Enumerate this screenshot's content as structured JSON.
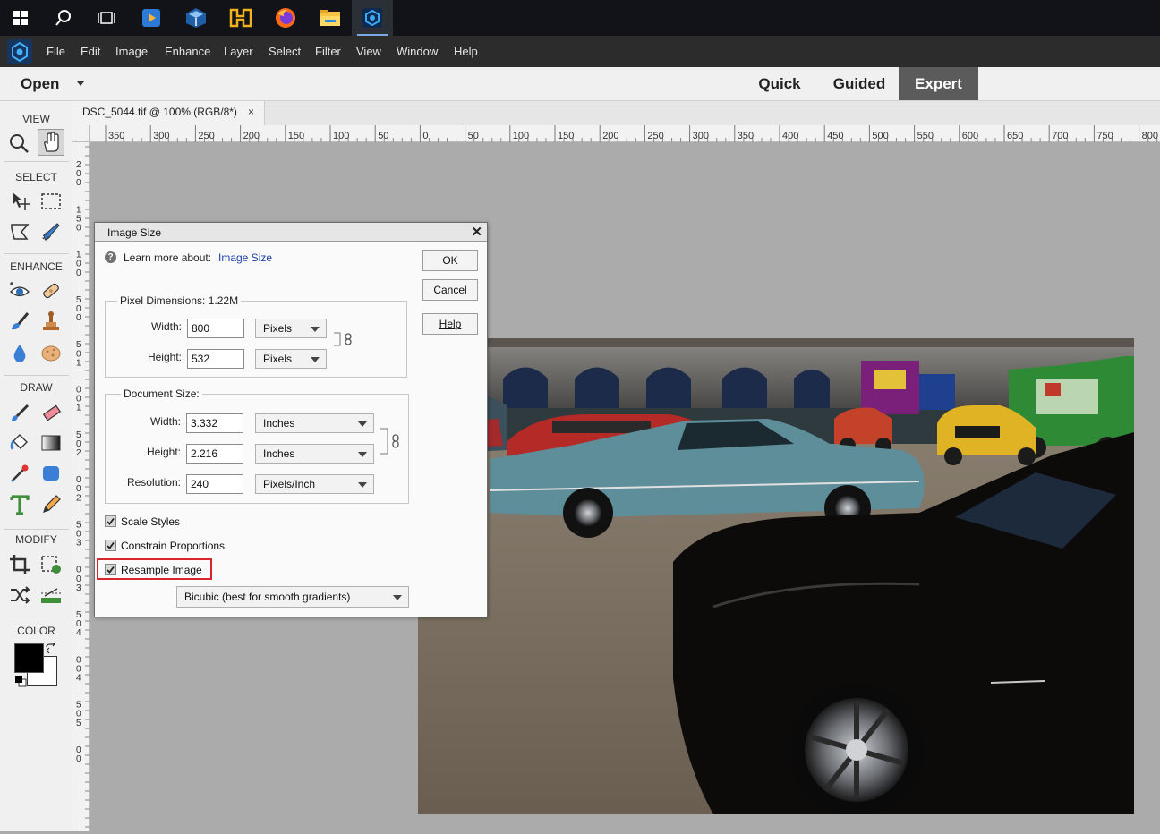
{
  "taskbar": {
    "icons": [
      "windows-start-icon",
      "search-icon",
      "task-view-icon",
      "media-player-icon",
      "virtualbox-icon",
      "vmware-icon",
      "firefox-icon",
      "file-explorer-icon",
      "photoshop-elements-icon"
    ]
  },
  "menubar": {
    "items": [
      "File",
      "Edit",
      "Image",
      "Enhance",
      "Layer",
      "Select",
      "Filter",
      "View",
      "Window",
      "Help"
    ]
  },
  "appbar": {
    "open_label": "Open",
    "modes": [
      "Quick",
      "Guided",
      "Expert"
    ],
    "active_mode": "Expert"
  },
  "toolbox": {
    "sections": [
      "VIEW",
      "SELECT",
      "ENHANCE",
      "DRAW",
      "MODIFY",
      "COLOR"
    ],
    "foreground_color": "#000000",
    "background_color": "#ffffff"
  },
  "document": {
    "tab_title": "DSC_5044.tif @ 100% (RGB/8*)",
    "close_glyph": "×"
  },
  "ruler": {
    "h_labels": [
      "350",
      "300",
      "250",
      "200",
      "150",
      "100",
      "50",
      "0",
      "50",
      "100",
      "150",
      "200",
      "250",
      "300",
      "350",
      "400",
      "450",
      "500",
      "550",
      "600",
      "650",
      "700",
      "750",
      "800"
    ],
    "v_labels": [
      "2",
      "0",
      "0",
      "1",
      "5",
      "0",
      "1",
      "0",
      "0",
      "5",
      "0",
      "0",
      "5",
      "0",
      "1",
      "0",
      "0",
      "1",
      "5",
      "0",
      "2",
      "0",
      "0",
      "2",
      "5",
      "0",
      "3",
      "0",
      "0",
      "3",
      "5",
      "0",
      "4",
      "0",
      "0",
      "4",
      "5",
      "0",
      "5",
      "0",
      "0"
    ]
  },
  "dialog": {
    "title": "Image Size",
    "close_glyph": "✕",
    "learn_more_prefix": "Learn more about:",
    "learn_more_link": "Image Size",
    "buttons": {
      "ok": "OK",
      "cancel": "Cancel",
      "help": "Help"
    },
    "pixel_dimensions": {
      "label": "Pixel Dimensions:",
      "value": "1.22M",
      "width_label": "Width:",
      "width_value": "800",
      "width_unit": "Pixels",
      "height_label": "Height:",
      "height_value": "532",
      "height_unit": "Pixels"
    },
    "document_size": {
      "label": "Document Size:",
      "width_label": "Width:",
      "width_value": "3.332",
      "width_unit": "Inches",
      "height_label": "Height:",
      "height_value": "2.216",
      "height_unit": "Inches",
      "resolution_label": "Resolution:",
      "resolution_value": "240",
      "resolution_unit": "Pixels/Inch"
    },
    "checkboxes": {
      "scale_styles": "Scale Styles",
      "constrain_proportions": "Constrain Proportions",
      "resample_image": "Resample Image"
    },
    "resample_method": "Bicubic (best for smooth gradients)",
    "highlight_color": "#d9262c",
    "link_color": "#1a3fa6"
  }
}
